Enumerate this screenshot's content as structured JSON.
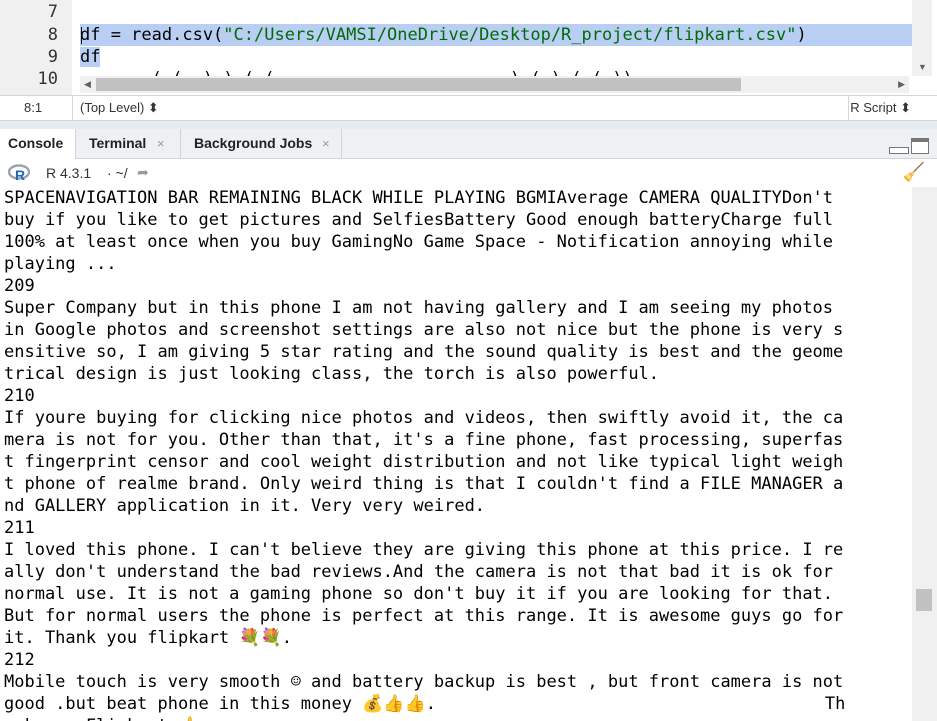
{
  "editor": {
    "line_numbers": [
      "7",
      "8",
      "9",
      "10"
    ],
    "lines": [
      {
        "text": ""
      },
      {
        "pre": "df = read.csv(",
        "str": "\"C:/Users/VAMSI/OneDrive/Desktop/R_project/flipkart.csv\"",
        "post": ")"
      },
      {
        "text": "df"
      },
      {
        "text": "       ( (  ) ) ( (                       ) ( ) ( ( ))"
      }
    ]
  },
  "status": {
    "position": "8:1",
    "scope": "(Top Level) ⬍",
    "file_type": "R Script ⬍"
  },
  "tabs": [
    {
      "label": "Console",
      "closable": false,
      "active": true
    },
    {
      "label": "Terminal",
      "closable": true,
      "active": false
    },
    {
      "label": "Background Jobs",
      "closable": true,
      "active": false
    }
  ],
  "console_header": {
    "r_version": "R 4.3.1",
    "working_dir": "· ~/"
  },
  "console_lines": [
    "SPACENAVIGATION BAR REMAINING BLACK WHILE PLAYING BGMIAverage CAMERA QUALITYDon't",
    "buy if you like to get pictures and SelfiesBattery Good enough batteryCharge full",
    "100% at least once when you buy GamingNo Game Space - Notification annoying while",
    "playing ...",
    "209",
    "Super Company but in this phone I am not having gallery and I am seeing my photos",
    "in Google photos and screenshot settings are also not nice but the phone is very s",
    "ensitive so, I am giving 5 star rating and the sound quality is best and the geome",
    "trical design is just looking class, the torch is also powerful.",
    "210",
    "If youre buying for clicking nice photos and videos, then swiftly avoid it, the ca",
    "mera is not for you. Other than that, it's a fine phone, fast processing, superfas",
    "t fingerprint censor and cool weight distribution and not like typical light weigh",
    "t phone of realme brand. Only weird thing is that I couldn't find a FILE MANAGER a",
    "nd GALLERY application in it. Very very weired.",
    "211",
    "I loved this phone. I can't believe they are giving this phone at this price. I re",
    "ally don't understand the bad reviews.And the camera is not that bad it is ok for",
    "normal use. It is not a gaming phone so don't buy it if you are looking for that.",
    "But for normal users the phone is perfect at this range. It is awesome guys go for",
    "it. Thank you flipkart 💐💐.",
    "212",
    "Mobile touch is very smooth ☺ and battery backup is best , but front camera is not",
    "good .but beat phone in this money 💰👍👍.                                      Th",
    "ank you Flipkart 👍"
  ],
  "colors": {
    "selection": "#b8cff3",
    "string": "#036a07",
    "r_logo": "#2266b8"
  },
  "icons": [
    "r-logo-icon",
    "go-to-directory-icon",
    "clear-console-icon",
    "minimize-icon",
    "maximize-icon"
  ]
}
